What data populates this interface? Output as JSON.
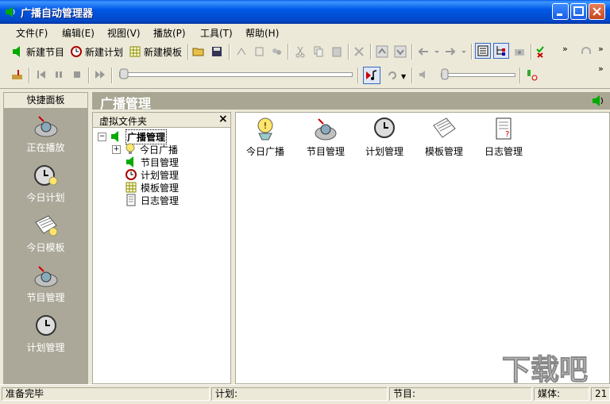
{
  "window": {
    "title": "广播自动管理器"
  },
  "menu": [
    "文件(F)",
    "编辑(E)",
    "视图(V)",
    "播放(P)",
    "工具(T)",
    "帮助(H)"
  ],
  "toolbar": {
    "new_program": "新建节目",
    "new_plan": "新建计划",
    "new_template": "新建模板"
  },
  "quick_panel": {
    "header": "快捷面板",
    "items": [
      "正在播放",
      "今日计划",
      "今日模板",
      "节目管理",
      "计划管理"
    ]
  },
  "main": {
    "title": "广播管理"
  },
  "tree": {
    "header": "虚拟文件夹",
    "root": "广播管理",
    "children": [
      "今日广播",
      "节目管理",
      "计划管理",
      "模板管理",
      "日志管理"
    ]
  },
  "content": {
    "items": [
      "今日广播",
      "节目管理",
      "计划管理",
      "模板管理",
      "日志管理"
    ]
  },
  "status": {
    "ready": "准备完毕",
    "plan_label": "计划:",
    "program_label": "节目:",
    "media_label": "媒体:",
    "media_value": "21"
  },
  "watermark": {
    "text": "下载吧"
  },
  "colors": {
    "title_bar": "#0058E6",
    "panel_gray": "#ACA899",
    "header_gray": "#A9A693"
  }
}
